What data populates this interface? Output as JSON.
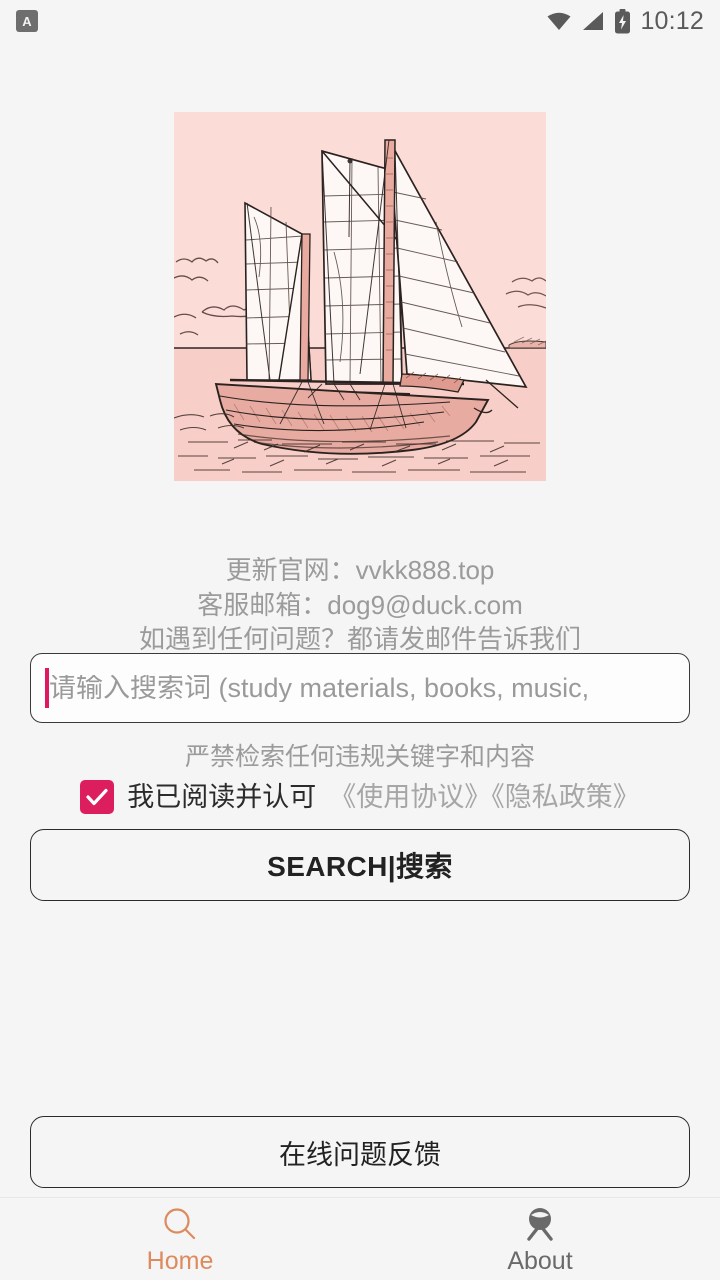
{
  "status_bar": {
    "app_icon_letter": "A",
    "icons": [
      "wifi-icon",
      "signal-icon",
      "battery-charging-icon"
    ],
    "time": "10:12"
  },
  "hero": {
    "alt": "sailboat-illustration",
    "palette": {
      "sky": "#fbddd8",
      "water": "#f9cfc8",
      "hull": "#e8b0a6",
      "ink": "#3a2e2c",
      "sail": "#fdf6f3"
    }
  },
  "info": {
    "line1": "更新官网：vvkk888.top",
    "line2": "客服邮箱：dog9@duck.com",
    "line3": "如遇到任何问题？都请发邮件告诉我们"
  },
  "search": {
    "placeholder": "请输入搜索词 (study materials, books, music,",
    "value": "",
    "caret_color": "#e0185f"
  },
  "warning": {
    "text": "严禁检索任何违规关键字和内容"
  },
  "agreement": {
    "checked": true,
    "checkbox_color": "#dd1e5e",
    "label": "我已阅读并认可",
    "links": "《使用协议》《隐私政策》"
  },
  "buttons": {
    "search": "SEARCH|搜索",
    "feedback": "在线问题反馈"
  },
  "bottom_nav": {
    "active": "Home",
    "active_color": "#dd8a5e",
    "inactive_color": "#6a6a6a",
    "items": [
      {
        "label": "Home",
        "icon": "search-icon"
      },
      {
        "label": "About",
        "icon": "about-person-icon"
      }
    ]
  }
}
